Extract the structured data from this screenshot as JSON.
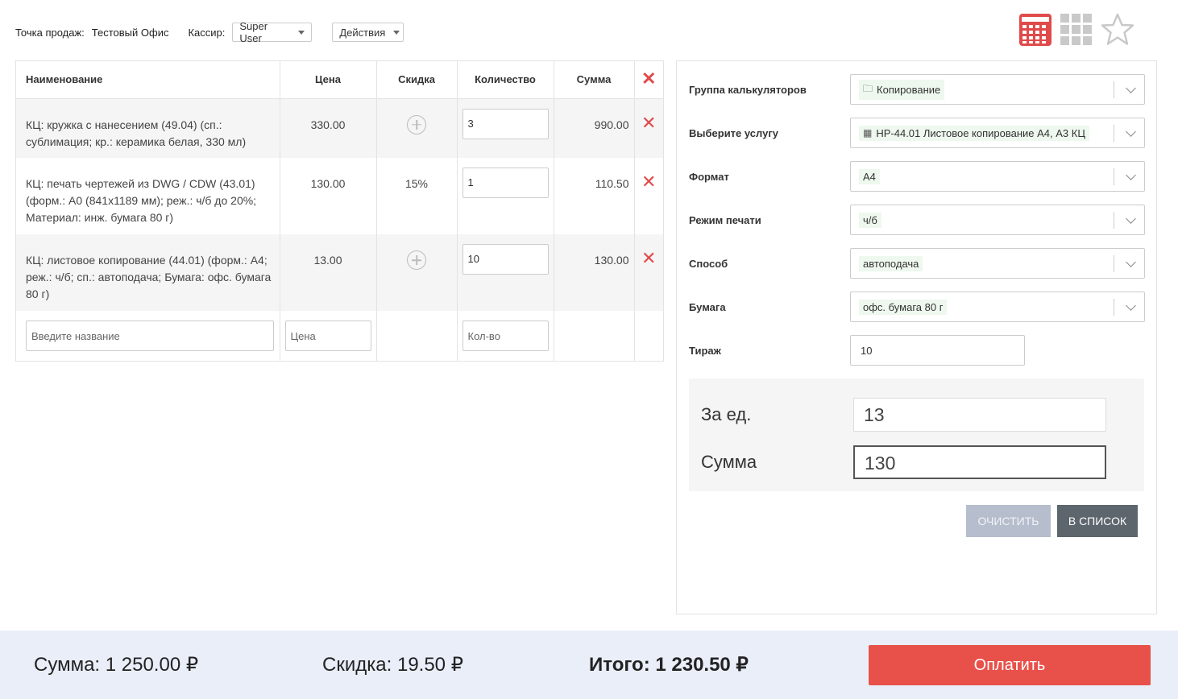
{
  "topbar": {
    "pos_label": "Точка продаж:",
    "pos_value": "Тестовый Офис",
    "cashier_label": "Кассир:",
    "cashier_value": "Super User",
    "actions_label": "Действия"
  },
  "view_icons": [
    "calculator-icon",
    "grid-icon",
    "star-icon"
  ],
  "colors": {
    "accent_red": "#e8514a",
    "calc_icon": "#e04a4a",
    "footer_bg": "#e9eef9"
  },
  "cart": {
    "headers": {
      "name": "Наименование",
      "price": "Цена",
      "discount": "Скидка",
      "qty": "Количество",
      "sum": "Сумма"
    },
    "rows": [
      {
        "name": "КЦ: кружка с нанесением (49.04) (сп.: сублимация; кр.: керамика белая, 330 мл)",
        "price": "330.00",
        "discount": "",
        "qty": "3",
        "sum": "990.00"
      },
      {
        "name": "КЦ: печать чертежей из DWG / CDW (43.01) (форм.: А0 (841x1189 мм); реж.: ч/б до 20%; Материал: инж. бумага 80 г)",
        "price": "130.00",
        "discount": "15%",
        "qty": "1",
        "sum": "110.50"
      },
      {
        "name": "КЦ: листовое копирование (44.01) (форм.: А4; реж.: ч/б; сп.: автоподача; Бумага: офс. бумага 80 г)",
        "price": "13.00",
        "discount": "",
        "qty": "10",
        "sum": "130.00"
      }
    ],
    "new_row": {
      "name_placeholder": "Введите название",
      "price_placeholder": "Цена",
      "qty_placeholder": "Кол-во"
    }
  },
  "calc": {
    "fields": [
      {
        "label": "Группа калькуляторов",
        "value": "Копирование",
        "icon": "folder-icon"
      },
      {
        "label": "Выберите услугу",
        "value": "НР-44.01 Листовое копирование А4, А3 КЦ",
        "icon": "calculator-icon"
      },
      {
        "label": "Формат",
        "value": "А4",
        "icon": ""
      },
      {
        "label": "Режим печати",
        "value": "ч/б",
        "icon": ""
      },
      {
        "label": "Способ",
        "value": "автоподача",
        "icon": ""
      },
      {
        "label": "Бумага",
        "value": "офс. бумага 80 г",
        "icon": ""
      }
    ],
    "tirazh_label": "Тираж",
    "tirazh_value": "10",
    "per_unit_label": "За ед.",
    "per_unit_value": "13",
    "sum_label": "Сумма",
    "sum_value": "130",
    "clear_label": "Очистить",
    "tolist_label": "В список"
  },
  "footer": {
    "sum_label": "Сумма:",
    "sum_value": "1 250.00 ₽",
    "discount_label": "Скидка:",
    "discount_value": "19.50 ₽",
    "total_label": "Итого:",
    "total_value": "1 230.50 ₽",
    "pay_label": "Оплатить"
  }
}
